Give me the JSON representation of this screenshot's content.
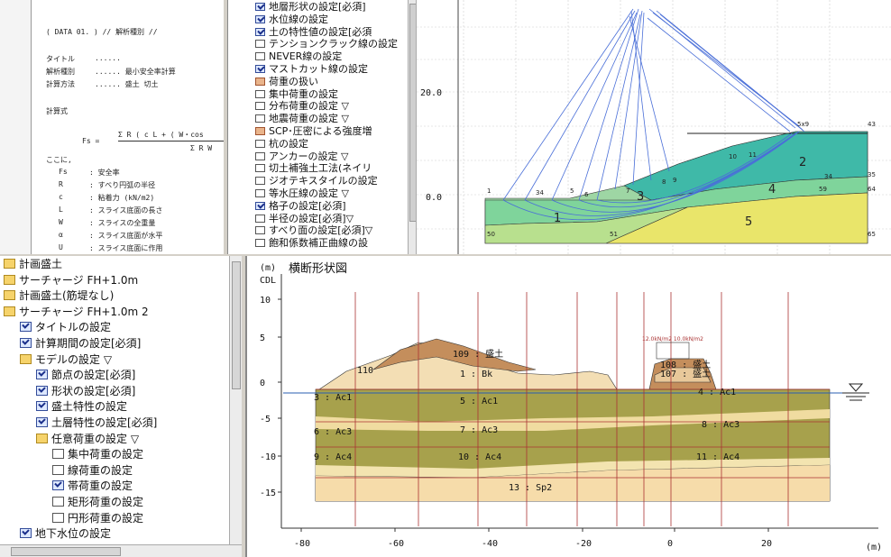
{
  "doc": {
    "header": "( DATA 01. )  // 解析種別 //",
    "rows": [
      {
        "k": "タイトル",
        "v": "......"
      },
      {
        "k": "解析種別",
        "v": "......  最小安全率計算"
      },
      {
        "k": "計算方法",
        "v": "......  盛土  切土"
      }
    ],
    "formula_heading": "計算式",
    "formula_lhs": "Fs =",
    "formula_num": "Σ R ( c L + ( W・cos",
    "formula_den": "Σ R W",
    "where": "ここに,",
    "symbols": [
      {
        "s": "Fs",
        "d": ": 安全率"
      },
      {
        "s": "R",
        "d": ": すべり円弧の半径"
      },
      {
        "s": "c",
        "d": ": 粘着力 (kN/m2)"
      },
      {
        "s": "L",
        "d": ": スライス底面の長さ"
      },
      {
        "s": "W",
        "d": ": スライスの全重量"
      },
      {
        "s": "α",
        "d": ": スライス底面が水平"
      },
      {
        "s": "U",
        "d": ": スライス底面に作用"
      }
    ]
  },
  "tree_top": [
    {
      "label": "地層形状の設定[必須]",
      "icon": "chk"
    },
    {
      "label": "水位線の設定",
      "icon": "chk"
    },
    {
      "label": "土の特性値の設定[必須",
      "icon": "chk"
    },
    {
      "label": "テンションクラック線の設定",
      "icon": "blank"
    },
    {
      "label": "NEVER線の設定",
      "icon": "blank"
    },
    {
      "label": "マストカット線の設定",
      "icon": "chk"
    },
    {
      "label": "荷重の扱い",
      "icon": "warn"
    },
    {
      "label": "集中荷重の設定",
      "icon": "blank"
    },
    {
      "label": "分布荷重の設定 ▽",
      "icon": "blank"
    },
    {
      "label": "地震荷重の設定 ▽",
      "icon": "blank"
    },
    {
      "label": "SCP･圧密による強度増",
      "icon": "warn"
    },
    {
      "label": "杭の設定",
      "icon": "blank"
    },
    {
      "label": "アンカーの設定 ▽",
      "icon": "blank"
    },
    {
      "label": "切土補強土工法(ネイリ",
      "icon": "blank"
    },
    {
      "label": "ジオテキスタイルの設定",
      "icon": "blank"
    },
    {
      "label": "等水圧線の設定 ▽",
      "icon": "blank"
    },
    {
      "label": "格子の設定[必須]",
      "icon": "chk"
    },
    {
      "label": "半径の設定[必須]▽",
      "icon": "blank"
    },
    {
      "label": "すべり面の設定[必須]▽",
      "icon": "blank"
    },
    {
      "label": "飽和係数補正曲線の設",
      "icon": "blank"
    }
  ],
  "tree_bottom": [
    {
      "label": "計画盛土",
      "icon": "fold",
      "indent": 1
    },
    {
      "label": "サーチャージ FH+1.0m",
      "icon": "fold",
      "indent": 1
    },
    {
      "label": "計画盛土(筋堤なし)",
      "icon": "fold",
      "indent": 1
    },
    {
      "label": "サーチャージ FH+1.0m 2",
      "icon": "fold",
      "indent": 1
    },
    {
      "label": "タイトルの設定",
      "icon": "chk",
      "indent": 2
    },
    {
      "label": "計算期間の設定[必須]",
      "icon": "chk",
      "indent": 2
    },
    {
      "label": "モデルの設定 ▽",
      "icon": "fold",
      "indent": 2
    },
    {
      "label": "節点の設定[必須]",
      "icon": "chk",
      "indent": 3
    },
    {
      "label": "形状の設定[必須]",
      "icon": "chk",
      "indent": 3
    },
    {
      "label": "盛土特性の設定",
      "icon": "chk",
      "indent": 3
    },
    {
      "label": "土層特性の設定[必須]",
      "icon": "chk",
      "indent": 3
    },
    {
      "label": "任意荷重の設定 ▽",
      "icon": "fold",
      "indent": 3
    },
    {
      "label": "集中荷重の設定",
      "icon": "blank",
      "indent": 4
    },
    {
      "label": "線荷重の設定",
      "icon": "blank",
      "indent": 4
    },
    {
      "label": "帯荷重の設定",
      "icon": "chk",
      "indent": 4
    },
    {
      "label": "矩形荷重の設定",
      "icon": "blank",
      "indent": 4
    },
    {
      "label": "円形荷重の設定",
      "icon": "blank",
      "indent": 4
    },
    {
      "label": "地下水位の設定",
      "icon": "chk",
      "indent": 2
    }
  ],
  "plot1": {
    "y_ticks": [
      "20.0",
      "0.0"
    ],
    "layer_labels": [
      "1",
      "2",
      "3",
      "4",
      "5"
    ],
    "node_labels": [
      "1",
      "34",
      "5",
      "6",
      "7",
      "8",
      "9",
      "10",
      "11",
      "34",
      "35",
      "59",
      "64",
      "65",
      "50",
      "51",
      "43",
      "5x9"
    ]
  },
  "section": {
    "title": "横断形状図",
    "unit_y": "(m)",
    "cdl": "CDL",
    "unit_x": "(m)",
    "y_ticks": [
      "10",
      "5",
      "0",
      "-5",
      "-10",
      "-15"
    ],
    "x_ticks": [
      "-80",
      "-60",
      "-40",
      "-20",
      "0",
      "20"
    ],
    "labels": {
      "fill_top": "109 : 盛土",
      "bk": "1 : Bk",
      "fill_small": "108 : 盛土",
      "fill_small2": "107 : 盛土",
      "l110": "110",
      "ac1_left": "3 : Ac1",
      "ac1_mid": "5 : Ac1",
      "ac1_right": "4 : Ac1",
      "ac3_left": "6 : Ac3",
      "ac3_mid": "7 : Ac3",
      "ac3_right": "8 : Ac3",
      "ac4_left": "9 : Ac4",
      "ac4_mid": "10 : Ac4",
      "ac4_right": "11 : Ac4",
      "sp2": "13 : Sp2",
      "load_note": "12.0kN/m2 10.0kN/m2"
    }
  }
}
